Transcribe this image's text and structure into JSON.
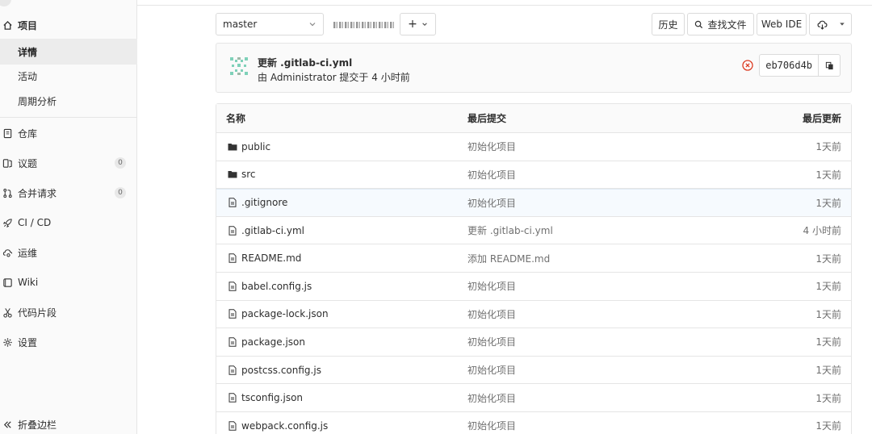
{
  "sidebar": {
    "project": "项目",
    "sub_items": [
      "详情",
      "活动",
      "周期分析"
    ],
    "items": [
      {
        "label": "仓库",
        "icon": "book-icon",
        "count": null
      },
      {
        "label": "议题",
        "icon": "issues-icon",
        "count": "0"
      },
      {
        "label": "合并请求",
        "icon": "merge-request-icon",
        "count": "0"
      },
      {
        "label": "CI / CD",
        "icon": "rocket-icon",
        "count": null
      },
      {
        "label": "运维",
        "icon": "cloud-gear-icon",
        "count": null
      },
      {
        "label": "Wiki",
        "icon": "wiki-icon",
        "count": null
      },
      {
        "label": "代码片段",
        "icon": "scissors-icon",
        "count": null
      },
      {
        "label": "设置",
        "icon": "gear-icon",
        "count": null
      }
    ],
    "collapse": "折叠边栏"
  },
  "toolbar": {
    "branch": "master",
    "plus": "+",
    "history": "历史",
    "find_file": "查找文件",
    "web_ide": "Web IDE"
  },
  "commit": {
    "title": "更新 .gitlab-ci.yml",
    "meta": "由 Administrator 提交于 4 小时前",
    "sha": "eb706d4b",
    "status_color": "#db3b21"
  },
  "table": {
    "headers": {
      "name": "名称",
      "last_commit": "最后提交",
      "last_update": "最后更新"
    },
    "rows": [
      {
        "name": "public",
        "type": "folder",
        "commit": "初始化项目",
        "updated": "1天前"
      },
      {
        "name": "src",
        "type": "folder",
        "commit": "初始化项目",
        "updated": "1天前"
      },
      {
        "name": ".gitignore",
        "type": "file",
        "commit": "初始化项目",
        "updated": "1天前"
      },
      {
        "name": ".gitlab-ci.yml",
        "type": "file",
        "commit": "更新 .gitlab-ci.yml",
        "updated": "4 小时前"
      },
      {
        "name": "README.md",
        "type": "file",
        "commit": "添加 README.md",
        "updated": "1天前"
      },
      {
        "name": "babel.config.js",
        "type": "file",
        "commit": "初始化项目",
        "updated": "1天前"
      },
      {
        "name": "package-lock.json",
        "type": "file",
        "commit": "初始化项目",
        "updated": "1天前"
      },
      {
        "name": "package.json",
        "type": "file",
        "commit": "初始化项目",
        "updated": "1天前"
      },
      {
        "name": "postcss.config.js",
        "type": "file",
        "commit": "初始化项目",
        "updated": "1天前"
      },
      {
        "name": "tsconfig.json",
        "type": "file",
        "commit": "初始化项目",
        "updated": "1天前"
      },
      {
        "name": "webpack.config.js",
        "type": "file",
        "commit": "初始化项目",
        "updated": "1天前"
      }
    ]
  }
}
